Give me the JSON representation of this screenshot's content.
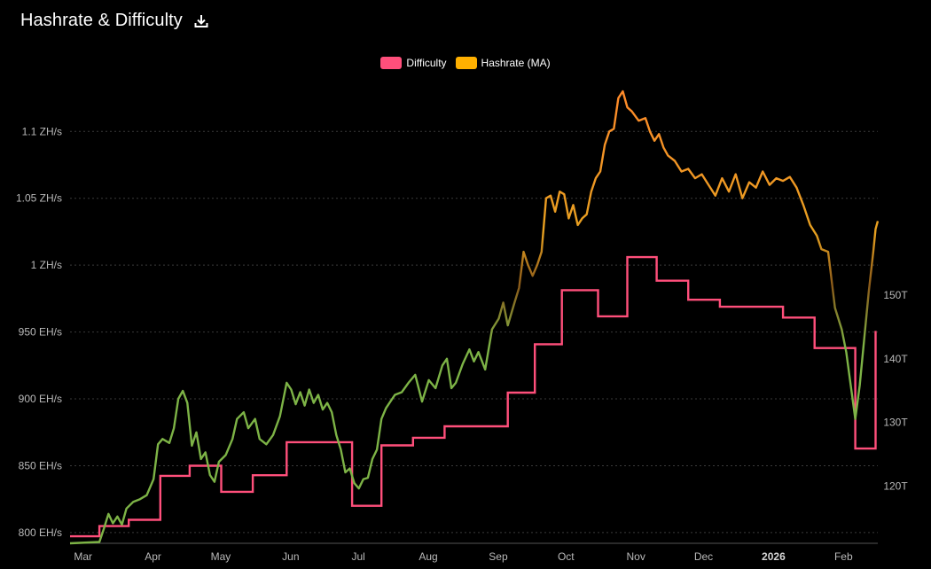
{
  "header": {
    "title": "Hashrate & Difficulty",
    "download_icon": "download-icon"
  },
  "colors": {
    "background": "#000000",
    "difficulty": "#ff4f7b",
    "hashrate_low": "#7db346",
    "hashrate_mid": "#e6a020",
    "hashrate_high": "#ff8a2a",
    "grid": "#3a3a3a"
  },
  "chart_data": {
    "type": "line",
    "title": "Hashrate & Difficulty",
    "legend_position": "top-center",
    "grid": "horizontal dotted",
    "x_axis": {
      "labels": [
        "Mar",
        "Apr",
        "May",
        "Jun",
        "Jul",
        "Aug",
        "Sep",
        "Oct",
        "Nov",
        "Dec",
        "2026",
        "Feb"
      ],
      "range": [
        "2025-02-24",
        "2026-02-17"
      ]
    },
    "y_left": {
      "labels": [
        "800 EH/s",
        "850 EH/s",
        "900 EH/s",
        "950 EH/s",
        "1 ZH/s",
        "1.05 ZH/s",
        "1.1 ZH/s"
      ],
      "values": [
        800,
        850,
        900,
        950,
        1000,
        1050,
        1100
      ],
      "unit": "EH/s",
      "range": [
        792,
        1132
      ]
    },
    "y_right": {
      "labels": [
        "120T",
        "130T",
        "140T",
        "150T"
      ],
      "values": [
        120,
        130,
        140,
        150
      ],
      "range": [
        111.0,
        182.5
      ]
    },
    "series": [
      {
        "name": "Difficulty",
        "axis": "right",
        "step": true,
        "points": [
          [
            "2025-02-24",
            112.1
          ],
          [
            "2025-03-09",
            112.1
          ],
          [
            "2025-03-09",
            113.7
          ],
          [
            "2025-03-22",
            113.7
          ],
          [
            "2025-03-22",
            114.7
          ],
          [
            "2025-04-05",
            114.7
          ],
          [
            "2025-04-05",
            121.6
          ],
          [
            "2025-04-18",
            121.6
          ],
          [
            "2025-04-18",
            123.2
          ],
          [
            "2025-05-02",
            123.2
          ],
          [
            "2025-05-02",
            119.1
          ],
          [
            "2025-05-16",
            119.1
          ],
          [
            "2025-05-16",
            121.7
          ],
          [
            "2025-05-31",
            121.7
          ],
          [
            "2025-05-31",
            126.9
          ],
          [
            "2025-06-29",
            126.9
          ],
          [
            "2025-06-29",
            116.9
          ],
          [
            "2025-07-12",
            116.9
          ],
          [
            "2025-07-12",
            126.4
          ],
          [
            "2025-07-26",
            126.4
          ],
          [
            "2025-07-26",
            127.6
          ],
          [
            "2025-08-09",
            127.6
          ],
          [
            "2025-08-09",
            129.4
          ],
          [
            "2025-08-23",
            129.4
          ],
          [
            "2025-08-23",
            129.4
          ],
          [
            "2025-09-06",
            129.4
          ],
          [
            "2025-09-06",
            134.7
          ],
          [
            "2025-09-18",
            134.7
          ],
          [
            "2025-09-18",
            142.3
          ],
          [
            "2025-09-30",
            142.3
          ],
          [
            "2025-09-30",
            150.8
          ],
          [
            "2025-10-16",
            150.8
          ],
          [
            "2025-10-16",
            146.7
          ],
          [
            "2025-10-29",
            146.7
          ],
          [
            "2025-10-29",
            156.0
          ],
          [
            "2025-11-11",
            156.0
          ],
          [
            "2025-11-11",
            152.3
          ],
          [
            "2025-11-25",
            152.3
          ],
          [
            "2025-11-25",
            149.3
          ],
          [
            "2025-12-09",
            149.3
          ],
          [
            "2025-12-09",
            148.2
          ],
          [
            "2025-12-23",
            148.2
          ],
          [
            "2025-12-23",
            148.2
          ],
          [
            "2026-01-06",
            148.2
          ],
          [
            "2026-01-06",
            146.5
          ],
          [
            "2026-01-20",
            146.5
          ],
          [
            "2026-01-20",
            141.7
          ],
          [
            "2026-02-07",
            141.7
          ],
          [
            "2026-02-07",
            125.9
          ],
          [
            "2026-02-16",
            125.9
          ],
          [
            "2026-02-16",
            144.4
          ]
        ]
      },
      {
        "name": "Hashrate (MA)",
        "axis": "left",
        "points": [
          [
            "2025-02-24",
            792
          ],
          [
            "2025-03-09",
            793
          ],
          [
            "2025-03-11",
            803
          ],
          [
            "2025-03-13",
            814
          ],
          [
            "2025-03-15",
            807
          ],
          [
            "2025-03-17",
            812
          ],
          [
            "2025-03-19",
            806
          ],
          [
            "2025-03-21",
            818
          ],
          [
            "2025-03-24",
            823
          ],
          [
            "2025-03-27",
            825
          ],
          [
            "2025-03-30",
            828
          ],
          [
            "2025-04-02",
            840
          ],
          [
            "2025-04-04",
            866
          ],
          [
            "2025-04-06",
            870
          ],
          [
            "2025-04-09",
            867
          ],
          [
            "2025-04-11",
            878
          ],
          [
            "2025-04-13",
            900
          ],
          [
            "2025-04-15",
            906
          ],
          [
            "2025-04-17",
            897
          ],
          [
            "2025-04-19",
            865
          ],
          [
            "2025-04-21",
            875
          ],
          [
            "2025-04-23",
            855
          ],
          [
            "2025-04-25",
            860
          ],
          [
            "2025-04-27",
            843
          ],
          [
            "2025-04-29",
            838
          ],
          [
            "2025-05-01",
            853
          ],
          [
            "2025-05-04",
            858
          ],
          [
            "2025-05-07",
            870
          ],
          [
            "2025-05-09",
            885
          ],
          [
            "2025-05-12",
            890
          ],
          [
            "2025-05-14",
            878
          ],
          [
            "2025-05-17",
            885
          ],
          [
            "2025-05-19",
            870
          ],
          [
            "2025-05-22",
            866
          ],
          [
            "2025-05-25",
            873
          ],
          [
            "2025-05-28",
            887
          ],
          [
            "2025-05-31",
            912
          ],
          [
            "2025-06-02",
            907
          ],
          [
            "2025-06-04",
            896
          ],
          [
            "2025-06-06",
            905
          ],
          [
            "2025-06-08",
            895
          ],
          [
            "2025-06-10",
            907
          ],
          [
            "2025-06-12",
            897
          ],
          [
            "2025-06-14",
            903
          ],
          [
            "2025-06-16",
            892
          ],
          [
            "2025-06-18",
            897
          ],
          [
            "2025-06-20",
            890
          ],
          [
            "2025-06-22",
            873
          ],
          [
            "2025-06-24",
            862
          ],
          [
            "2025-06-26",
            845
          ],
          [
            "2025-06-28",
            848
          ],
          [
            "2025-06-30",
            837
          ],
          [
            "2025-07-02",
            833
          ],
          [
            "2025-07-04",
            840
          ],
          [
            "2025-07-06",
            841
          ],
          [
            "2025-07-08",
            855
          ],
          [
            "2025-07-10",
            862
          ],
          [
            "2025-07-12",
            885
          ],
          [
            "2025-07-14",
            893
          ],
          [
            "2025-07-16",
            898
          ],
          [
            "2025-07-18",
            903
          ],
          [
            "2025-07-21",
            905
          ],
          [
            "2025-07-24",
            912
          ],
          [
            "2025-07-27",
            918
          ],
          [
            "2025-07-30",
            898
          ],
          [
            "2025-08-02",
            914
          ],
          [
            "2025-08-05",
            908
          ],
          [
            "2025-08-08",
            925
          ],
          [
            "2025-08-10",
            930
          ],
          [
            "2025-08-12",
            908
          ],
          [
            "2025-08-14",
            912
          ],
          [
            "2025-08-17",
            926
          ],
          [
            "2025-08-20",
            937
          ],
          [
            "2025-08-22",
            928
          ],
          [
            "2025-08-24",
            935
          ],
          [
            "2025-08-27",
            922
          ],
          [
            "2025-08-30",
            952
          ],
          [
            "2025-09-02",
            960
          ],
          [
            "2025-09-04",
            972
          ],
          [
            "2025-09-06",
            955
          ],
          [
            "2025-09-09",
            972
          ],
          [
            "2025-09-11",
            983
          ],
          [
            "2025-09-13",
            1010
          ],
          [
            "2025-09-15",
            1000
          ],
          [
            "2025-09-17",
            992
          ],
          [
            "2025-09-19",
            1000
          ],
          [
            "2025-09-21",
            1010
          ],
          [
            "2025-09-23",
            1050
          ],
          [
            "2025-09-25",
            1052
          ],
          [
            "2025-09-27",
            1040
          ],
          [
            "2025-09-29",
            1055
          ],
          [
            "2025-10-01",
            1053
          ],
          [
            "2025-10-03",
            1035
          ],
          [
            "2025-10-05",
            1045
          ],
          [
            "2025-10-07",
            1030
          ],
          [
            "2025-10-09",
            1035
          ],
          [
            "2025-10-11",
            1038
          ],
          [
            "2025-10-13",
            1055
          ],
          [
            "2025-10-15",
            1065
          ],
          [
            "2025-10-17",
            1070
          ],
          [
            "2025-10-19",
            1090
          ],
          [
            "2025-10-21",
            1100
          ],
          [
            "2025-10-23",
            1102
          ],
          [
            "2025-10-25",
            1125
          ],
          [
            "2025-10-27",
            1130
          ],
          [
            "2025-10-29",
            1118
          ],
          [
            "2025-10-31",
            1115
          ],
          [
            "2025-11-03",
            1108
          ],
          [
            "2025-11-06",
            1110
          ],
          [
            "2025-11-08",
            1100
          ],
          [
            "2025-11-10",
            1093
          ],
          [
            "2025-11-12",
            1098
          ],
          [
            "2025-11-14",
            1088
          ],
          [
            "2025-11-16",
            1082
          ],
          [
            "2025-11-19",
            1078
          ],
          [
            "2025-11-22",
            1070
          ],
          [
            "2025-11-25",
            1072
          ],
          [
            "2025-11-28",
            1065
          ],
          [
            "2025-12-01",
            1068
          ],
          [
            "2025-12-04",
            1060
          ],
          [
            "2025-12-07",
            1052
          ],
          [
            "2025-12-10",
            1065
          ],
          [
            "2025-12-13",
            1055
          ],
          [
            "2025-12-16",
            1068
          ],
          [
            "2025-12-19",
            1050
          ],
          [
            "2025-12-22",
            1062
          ],
          [
            "2025-12-25",
            1058
          ],
          [
            "2025-12-28",
            1070
          ],
          [
            "2025-12-31",
            1060
          ],
          [
            "2026-01-03",
            1065
          ],
          [
            "2026-01-06",
            1063
          ],
          [
            "2026-01-09",
            1066
          ],
          [
            "2026-01-12",
            1058
          ],
          [
            "2026-01-15",
            1045
          ],
          [
            "2026-01-18",
            1030
          ],
          [
            "2026-01-21",
            1022
          ],
          [
            "2026-01-23",
            1012
          ],
          [
            "2026-01-26",
            1010
          ],
          [
            "2026-01-29",
            968
          ],
          [
            "2026-02-01",
            952
          ],
          [
            "2026-02-03",
            935
          ],
          [
            "2026-02-05",
            910
          ],
          [
            "2026-02-07",
            885
          ],
          [
            "2026-02-09",
            910
          ],
          [
            "2026-02-11",
            945
          ],
          [
            "2026-02-13",
            980
          ],
          [
            "2026-02-15",
            1010
          ],
          [
            "2026-02-16",
            1027
          ],
          [
            "2026-02-17",
            1033
          ]
        ]
      }
    ]
  }
}
